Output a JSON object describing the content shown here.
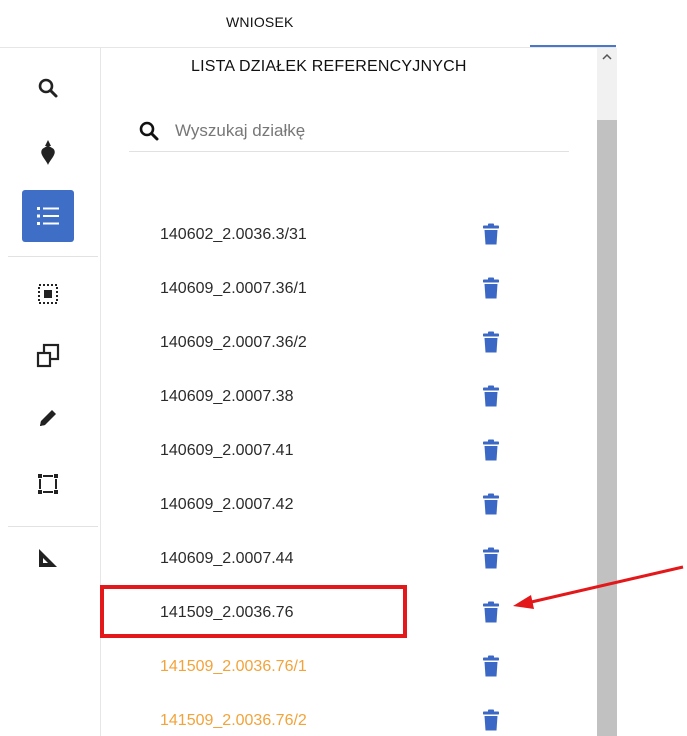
{
  "header": {
    "title": "WNIOSEK"
  },
  "toolbar": {
    "tools": [
      {
        "name": "search-tool",
        "icon": "search-icon"
      },
      {
        "name": "crop-tool",
        "icon": "beet-icon"
      },
      {
        "name": "list-tool",
        "icon": "list-icon",
        "active": true
      },
      {
        "name": "select-inside-tool",
        "icon": "select-inside-icon"
      },
      {
        "name": "copy-tool",
        "icon": "copy-icon"
      },
      {
        "name": "edit-tool",
        "icon": "pencil-icon"
      },
      {
        "name": "select-area-tool",
        "icon": "select-area-icon"
      },
      {
        "name": "measure-tool",
        "icon": "ruler-triangle-icon"
      }
    ]
  },
  "panel": {
    "title": "LISTA DZIAŁEK REFERENCYJNYCH",
    "search": {
      "placeholder": "Wyszukaj działkę",
      "value": ""
    },
    "items": [
      {
        "label": "140602_2.0036.3/31",
        "color": "default"
      },
      {
        "label": "140609_2.0007.36/1",
        "color": "default"
      },
      {
        "label": "140609_2.0007.36/2",
        "color": "default"
      },
      {
        "label": "140609_2.0007.38",
        "color": "default"
      },
      {
        "label": "140609_2.0007.41",
        "color": "default"
      },
      {
        "label": "140609_2.0007.42",
        "color": "default"
      },
      {
        "label": "140609_2.0007.44",
        "color": "default"
      },
      {
        "label": "141509_2.0036.76",
        "color": "default"
      },
      {
        "label": "141509_2.0036.76/1",
        "color": "orange"
      },
      {
        "label": "141509_2.0036.76/2",
        "color": "orange"
      }
    ]
  },
  "colors": {
    "accent": "#3f6ec6",
    "trash": "#3c68c5",
    "orange_label": "#f2a33a",
    "annotation_red": "#e3181b"
  }
}
